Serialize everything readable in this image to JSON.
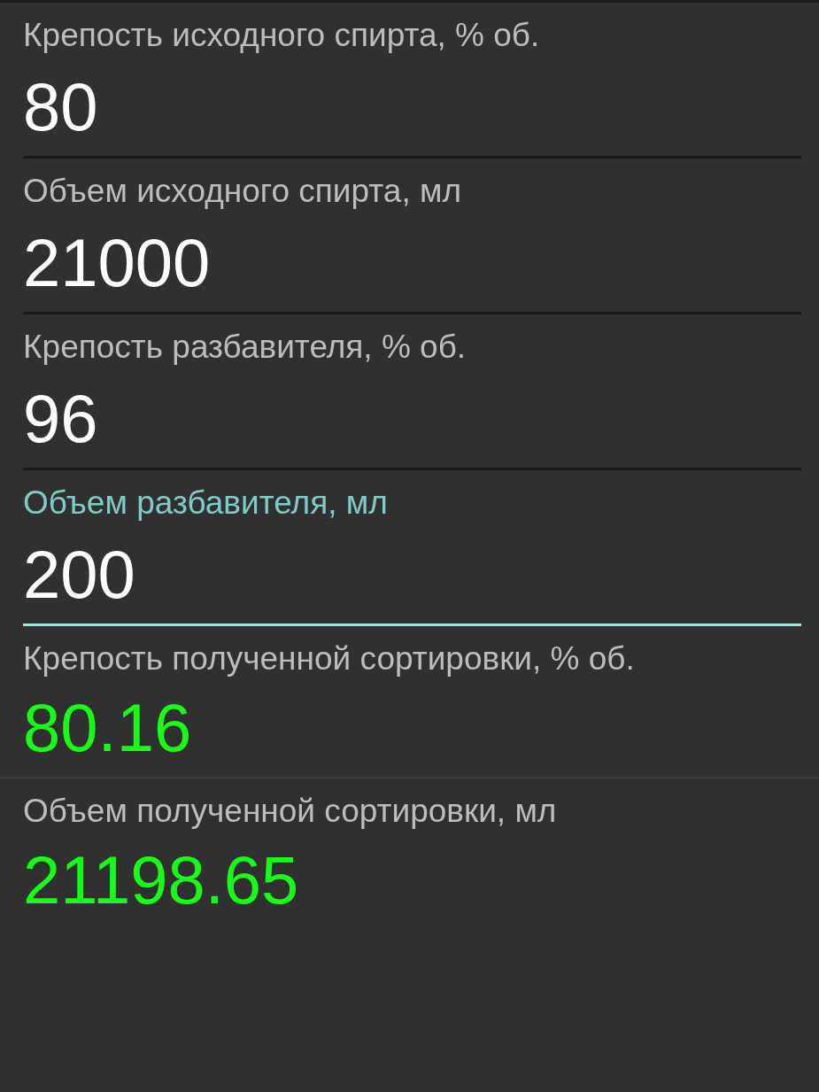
{
  "fields": [
    {
      "kind": "input",
      "label": "Крепость исходного спирта, % об.",
      "value": "80",
      "focused": false
    },
    {
      "kind": "input",
      "label": "Объем исходного спирта, мл",
      "value": "21000",
      "focused": false
    },
    {
      "kind": "input",
      "label": "Крепость разбавителя, % об.",
      "value": "96",
      "focused": false
    },
    {
      "kind": "input",
      "label": "Объем разбавителя, мл",
      "value": "200",
      "focused": true
    },
    {
      "kind": "result",
      "label": "Крепость полученной сортировки, % об.",
      "value": "80.16"
    },
    {
      "kind": "result",
      "label": "Объем полученной сортировки, мл",
      "value": "21198.65"
    }
  ]
}
